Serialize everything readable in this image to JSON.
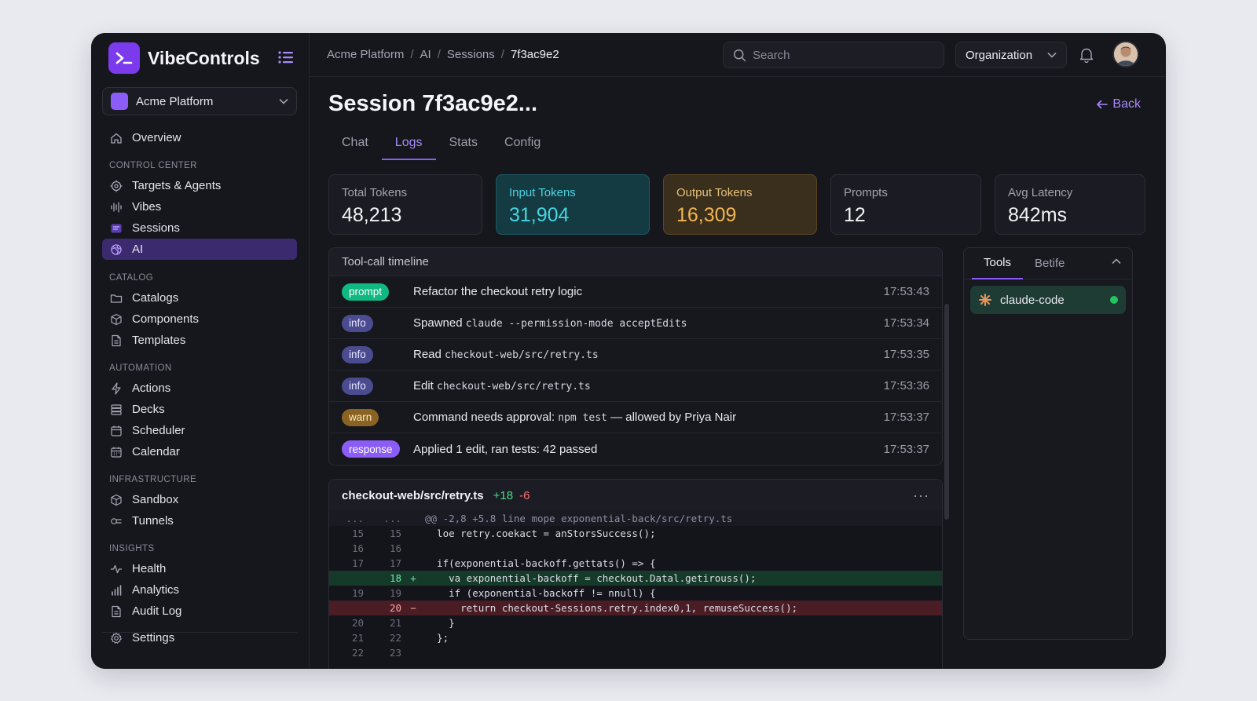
{
  "app": {
    "name": "VibeControls"
  },
  "org_select": {
    "label": "Acme Platform"
  },
  "sidebar": {
    "overview": "Overview",
    "sections": {
      "control_center": "CONTROL CENTER",
      "catalog": "CATALOG",
      "automation": "AUTOMATION",
      "infrastructure": "INFRASTRUCTURE",
      "insights": "INSIGHTS"
    },
    "items": {
      "targets": "Targets & Agents",
      "vibes": "Vibes",
      "sessions": "Sessions",
      "ai": "AI",
      "catalogs": "Catalogs",
      "components": "Components",
      "templates": "Templates",
      "actions": "Actions",
      "decks": "Decks",
      "scheduler": "Scheduler",
      "calendar": "Calendar",
      "sandbox": "Sandbox",
      "tunnels": "Tunnels",
      "health": "Health",
      "analytics": "Analytics",
      "audit_log": "Audit Log",
      "settings": "Settings"
    }
  },
  "topbar": {
    "breadcrumb": [
      "Acme Platform",
      "AI",
      "Sessions",
      "7f3ac9e2"
    ],
    "separator": "/",
    "search_placeholder": "Search",
    "org_dropdown": "Organization"
  },
  "page": {
    "title": "Session 7f3ac9e2...",
    "back": "Back",
    "tabs": [
      "Chat",
      "Logs",
      "Stats",
      "Config"
    ],
    "active_tab": "Logs"
  },
  "stats": [
    {
      "label": "Total Tokens",
      "value": "48,213"
    },
    {
      "label": "Input Tokens",
      "value": "31,904"
    },
    {
      "label": "Output Tokens",
      "value": "16,309"
    },
    {
      "label": "Prompts",
      "value": "12"
    },
    {
      "label": "Avg Latency",
      "value": "842ms"
    }
  ],
  "timeline": {
    "title": "Tool-call timeline",
    "rows": [
      {
        "badge": "prompt",
        "text": "Refactor the checkout retry logic",
        "time": "17:53:43"
      },
      {
        "badge": "info",
        "text": "Spawned",
        "code": "claude --permission-mode acceptEdits",
        "time": "17:53:34"
      },
      {
        "badge": "info",
        "text": "Read",
        "code": "checkout-web/src/retry.ts",
        "time": "17:53:35"
      },
      {
        "badge": "info",
        "text": "Edit",
        "code": "checkout-web/src/retry.ts",
        "time": "17:53:36"
      },
      {
        "badge": "warn",
        "text": "Command needs approval:",
        "code": "npm test",
        "suffix": "— allowed by Priya Nair",
        "time": "17:53:37"
      },
      {
        "badge": "response",
        "text": "Applied 1 edit, ran tests: 42 passed",
        "time": "17:53:37"
      }
    ]
  },
  "diff": {
    "file": "checkout-web/src/retry.ts",
    "additions": "+18",
    "deletions": "-6",
    "more": "···",
    "lines": [
      {
        "type": "hunk",
        "l1": "...",
        "l2": "...",
        "mk": "",
        "text": "@@ -2,8 +5.8 line mope exponential-back/src/retry.ts"
      },
      {
        "type": "ctx",
        "l1": "15",
        "l2": "15",
        "mk": "",
        "text": "  loe retry.coekact = anStorsSuccess();"
      },
      {
        "type": "ctx",
        "l1": "16",
        "l2": "16",
        "mk": "",
        "text": ""
      },
      {
        "type": "ctx",
        "l1": "17",
        "l2": "17",
        "mk": "",
        "text": "  if(exponential-backoff.gettats() => {"
      },
      {
        "type": "added",
        "l1": "",
        "l2": "18",
        "mk": "+",
        "text": "    va exponential-backoff = checkout.Datal.getirouss();"
      },
      {
        "type": "ctx",
        "l1": "19",
        "l2": "19",
        "mk": "",
        "text": "    if (exponential-backoff != nnull) {"
      },
      {
        "type": "removed",
        "l1": "",
        "l2": "20",
        "mk": "−",
        "text": "      return checkout-Sessions.retry.index0,1, remuseSuccess();"
      },
      {
        "type": "ctx",
        "l1": "20",
        "l2": "21",
        "mk": "",
        "text": "    }"
      },
      {
        "type": "ctx",
        "l1": "21",
        "l2": "22",
        "mk": "",
        "text": "  };"
      },
      {
        "type": "ctx",
        "l1": "22",
        "l2": "23",
        "mk": "",
        "text": ""
      }
    ]
  },
  "panel": {
    "tabs": [
      "Tools",
      "Betife"
    ],
    "tool": "claude-code"
  }
}
